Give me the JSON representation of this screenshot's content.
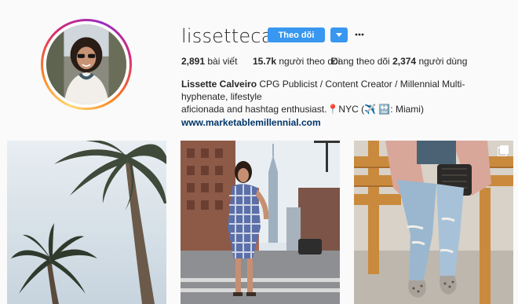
{
  "profile": {
    "username": "lissettecalv",
    "follow_label": "Theo dõi",
    "posts_count": "2,891",
    "posts_label": "bài viết",
    "followers_count": "15.7k",
    "followers_label": "người theo dõi",
    "following_prefix": "Đang theo dõi",
    "following_count": "2,374",
    "following_label": "người dùng",
    "full_name": "Lissette Calveiro",
    "bio_line1": " CPG Publicist / Content Creator / Millennial Multi-hyphenate, lifestyle",
    "bio_line2": "aficionada and hashtag enthusiast.📍NYC (✈️ 🔛: Miami)",
    "website": "www.marketablemillennial.com"
  },
  "icons": {
    "dropdown": "chevron-down-icon",
    "more": "more-options-icon",
    "multi_post": "multiple-photos-icon"
  },
  "colors": {
    "accent": "#3897f0",
    "link": "#003569",
    "background": "#fafafa"
  },
  "posts": [
    {
      "subject": "palm-trees"
    },
    {
      "subject": "city-street-outfit"
    },
    {
      "subject": "bench-outfit"
    }
  ]
}
